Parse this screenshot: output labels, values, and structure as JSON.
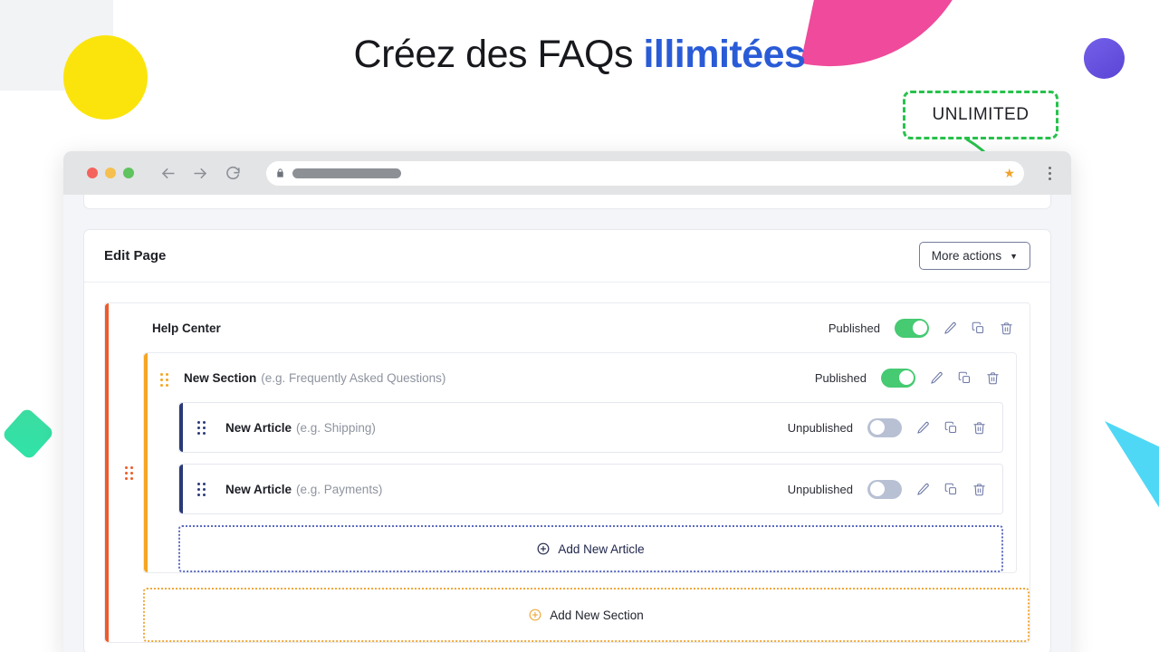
{
  "headline": {
    "normal": "Créez des FAQs ",
    "bold": "illimitées",
    "accent_color": "#2a5bd7"
  },
  "badge": {
    "label": "UNLIMITED",
    "border_color": "#27c24c",
    "arrow_color": "#27c24c"
  },
  "browser": {
    "traffic_lights": [
      "red",
      "yellow",
      "green"
    ],
    "back_icon": "back-arrow-icon",
    "forward_icon": "forward-arrow-icon",
    "reload_icon": "reload-icon",
    "lock_icon": "lock-icon",
    "star_icon": "★",
    "menu_icon": "kebab-menu-icon",
    "url_value": ""
  },
  "app": {
    "page_title": "Edit Page",
    "more_actions": {
      "label": "More actions",
      "caret": "▼"
    },
    "tree": {
      "page": {
        "label": "Help Center",
        "hint": "",
        "state": "Published",
        "toggle": "on",
        "bar_color": "#ef5a29",
        "handle_color": "#ef5a29"
      },
      "section": {
        "label": "New Section",
        "hint": "(e.g. Frequently Asked Questions)",
        "state": "Published",
        "toggle": "on",
        "bar_color": "#f5a623",
        "handle_color": "#f5a623"
      },
      "articles": [
        {
          "label": "New Article",
          "hint": "(e.g. Shipping)",
          "state": "Unpublished",
          "toggle": "off",
          "bar_color": "#2a3a78",
          "handle_color": "#2a3a78"
        },
        {
          "label": "New Article",
          "hint": "(e.g. Payments)",
          "state": "Unpublished",
          "toggle": "off",
          "bar_color": "#2a3a78",
          "handle_color": "#2a3a78"
        }
      ],
      "add_article": {
        "label": "Add New Article",
        "icon": "plus-circle-icon",
        "color": "#21274d"
      },
      "add_section": {
        "label": "Add New Section",
        "icon": "plus-circle-icon",
        "color": "#f0a93c"
      }
    },
    "row_icons": {
      "edit": "pencil-icon",
      "duplicate": "copy-icon",
      "delete": "trash-icon"
    }
  },
  "decorations": {
    "yellow_circle": "#fbe40c",
    "pink_pie": "#ef4a9b",
    "purple_circle": "#6a56e0",
    "green_diamond": "#35dfa4",
    "cyan_triangle": "#4fd8f5",
    "gray_rect": "#f2f3f5"
  }
}
